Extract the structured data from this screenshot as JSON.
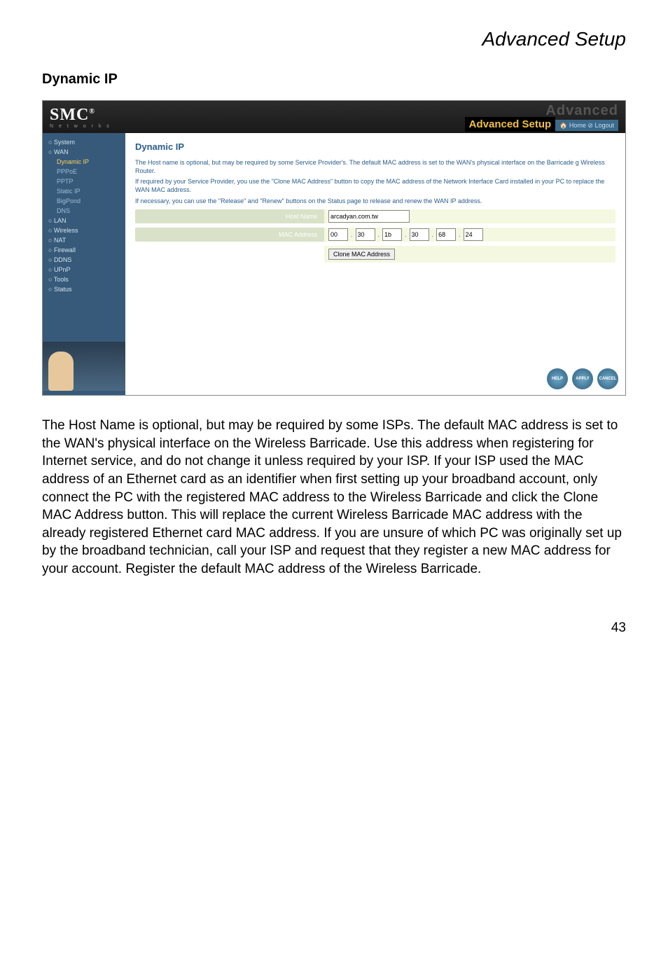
{
  "page": {
    "header": "Advanced Setup",
    "section_title": "Dynamic IP",
    "page_number": "43"
  },
  "screenshot": {
    "logo": "SMC",
    "logo_reg": "®",
    "logo_sub": "N e t w o r k s",
    "brand_word": "Advanced",
    "brand_setup": "Advanced Setup",
    "home_link": "Home",
    "logout_link": "Logout",
    "sidebar": {
      "items": [
        {
          "label": "System",
          "cls": "top"
        },
        {
          "label": "WAN",
          "cls": "top"
        },
        {
          "label": "Dynamic IP",
          "cls": "sub active"
        },
        {
          "label": "PPPoE",
          "cls": "sub"
        },
        {
          "label": "PPTP",
          "cls": "sub"
        },
        {
          "label": "Static IP",
          "cls": "sub"
        },
        {
          "label": "BigPond",
          "cls": "sub"
        },
        {
          "label": "DNS",
          "cls": "sub"
        },
        {
          "label": "LAN",
          "cls": "top"
        },
        {
          "label": "Wireless",
          "cls": "top"
        },
        {
          "label": "NAT",
          "cls": "top"
        },
        {
          "label": "Firewall",
          "cls": "top"
        },
        {
          "label": "DDNS",
          "cls": "top"
        },
        {
          "label": "UPnP",
          "cls": "top"
        },
        {
          "label": "Tools",
          "cls": "top"
        },
        {
          "label": "Status",
          "cls": "top"
        }
      ]
    },
    "content": {
      "title": "Dynamic IP",
      "p1": "The Host name is optional, but may be required by some Service Provider's. The default MAC address is set to the WAN's physical interface on the Barricade g Wireless Router.",
      "p2": "If required by your Service Provider, you use the \"Clone MAC Address\" button to copy the MAC address of the Network Interface Card installed in your PC to replace the WAN MAC address.",
      "p3": "If necessary, you can use the \"Release\" and \"Renew\" buttons on the Status page to release and renew the WAN IP address.",
      "host_label": "Host Name",
      "host_value": "arcadyan.com.tw",
      "mac_label": "MAC Address",
      "mac": [
        "00",
        "30",
        "1b",
        "30",
        "68",
        "24"
      ],
      "clone_btn": "Clone MAC Address",
      "icons": [
        "HELP",
        "APPLY",
        "CANCEL"
      ]
    }
  },
  "body_text": "The Host Name is optional, but may be required by some ISPs. The default MAC address is set to the WAN's physical interface on the Wireless Barricade. Use this address when registering for Internet service, and do not change it unless required by your ISP. If your ISP used the MAC address of an Ethernet card as an identifier when first setting up your broadband account, only connect the PC with the registered MAC address to the Wireless Barricade and click the Clone MAC Address button. This will replace the current Wireless Barricade MAC address with the already registered Ethernet card MAC address. If you are unsure of which PC was originally set up by the broadband technician, call your ISP and request that they register a new MAC address for your account. Register the default MAC address of the Wireless Barricade."
}
